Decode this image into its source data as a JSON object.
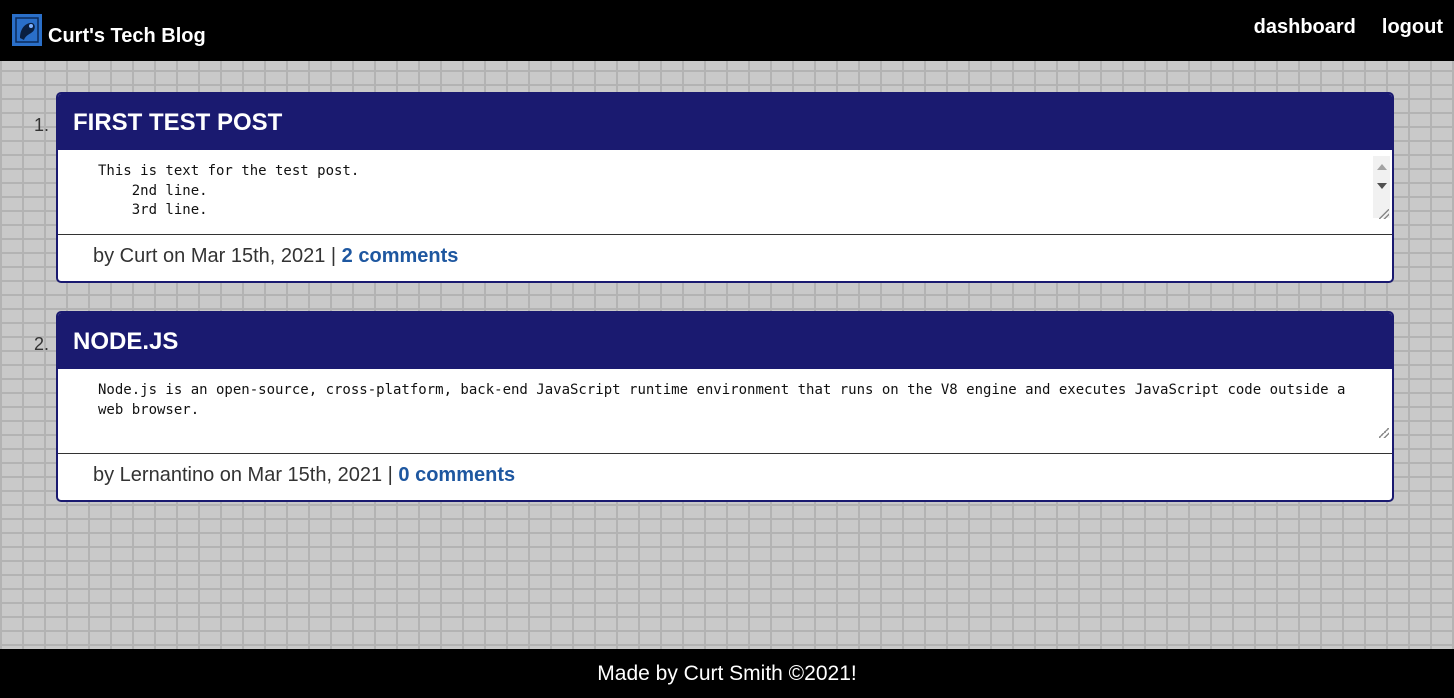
{
  "header": {
    "brand": "Curt's Tech Blog",
    "nav": [
      "dashboard",
      "logout"
    ]
  },
  "posts": [
    {
      "number": "1.",
      "title": "FIRST TEST POST",
      "body": "This is text for the test post.\n    2nd line.\n    3rd line.",
      "meta_prefix": "by Curt on Mar 15th, 2021 | ",
      "comments": "2 comments"
    },
    {
      "number": "2.",
      "title": "NODE.JS",
      "body": "Node.js is an open-source, cross-platform, back-end JavaScript runtime environment that runs on the V8 engine and executes JavaScript code outside a web browser.",
      "meta_prefix": "by Lernantino on Mar 15th, 2021 | ",
      "comments": "0 comments"
    }
  ],
  "footer": {
    "text": "Made by Curt Smith ©2021!"
  },
  "colors": {
    "header_bg": "#000000",
    "card_header": "#1a1a70",
    "link": "#1e57a0",
    "page_bg": "#c9c9c9"
  }
}
